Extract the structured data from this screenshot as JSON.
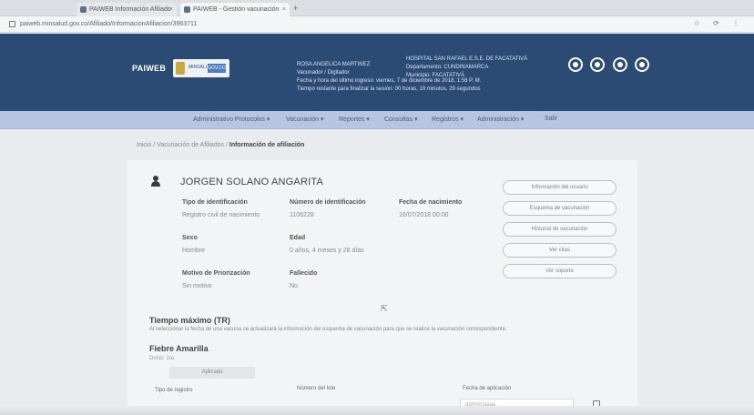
{
  "browser": {
    "tabs": [
      {
        "label": "PAIWEB Información Afiliado"
      },
      {
        "label": "PAIWEB - Gestión vacunación"
      }
    ],
    "new_tab_symbol": "+",
    "url": "paiweb.minsalud.gov.co/Afiliado/InformacionAfiliacion/3963711",
    "toolbar_icons": "☆ ⟳ ⋮"
  },
  "header": {
    "brand": "PAIWEB",
    "gov_label": "MINSALUD",
    "gov_badge": "GOV.CO",
    "user_name": "ROSA ANGELICA MARTINEZ",
    "user_role": "Vacunador / Digitador",
    "session_line_1": "Fecha y hora del último ingreso: viernes, 7 de diciembre de 2018, 1:56 P. M.",
    "session_line_2": "Tiempo restante para finalizar la sesión: 00 horas, 19 minutos, 29 segundos",
    "entity_name": "HOSPITAL SAN RAFAEL E.S.E. DE FACATATIVÁ",
    "entity_dept": "Departamento: CUNDINAMARCA",
    "entity_city": "Municipio: FACATATIVÁ"
  },
  "nav": {
    "items": [
      "Administrativo Protocolos ▾",
      "Vacunación ▾",
      "Reportes ▾",
      "Consultas ▾",
      "Registros ▾",
      "Administración ▾",
      "Salir"
    ]
  },
  "breadcrumb": {
    "home": "Inicio",
    "sep": "/",
    "middle": "Vacunación de Afiliados",
    "current": "Información de afiliación"
  },
  "person": {
    "name": "JORGEN SOLANO ANGARITA",
    "fields": [
      {
        "label": "Tipo de identificación",
        "value": "Registro civil de nacimiento"
      },
      {
        "label": "Número de identificación",
        "value": "1106228"
      },
      {
        "label": "Fecha de nacimiento",
        "value": "16/07/2018 00:00"
      },
      {
        "label": "Sexo",
        "value": "Hombre"
      },
      {
        "label": "Edad",
        "value": "0 años, 4 meses y 28 días"
      },
      {
        "label": "Motivo de Priorización",
        "value": "Sin motivo"
      },
      {
        "label": "Fallecido",
        "value": "No"
      }
    ]
  },
  "actions": [
    "Información del usuario",
    "Esquema de vacunación",
    "Historial de vacunación",
    "Ver citas",
    "Ver soporte"
  ],
  "section": {
    "title": "Tiempo máximo (TR)",
    "description": "Al seleccionar la fecha de una vacuna se actualizará la información del esquema de vacunación para que se realice la vacunación correspondiente.",
    "sub_title": "Fiebre Amarilla",
    "sub_line": "Dosis: 1ra",
    "pill_label": "Aplicado"
  },
  "bottom": {
    "label_1": "Tipo de registro",
    "label_2": "Número del lote",
    "label_3": "Fecha de aplicación",
    "date_placeholder": "dd/mm/aaaa"
  },
  "icon_names": [
    "person-icon",
    "lock-icon",
    "calendar-icon",
    "user-circle-icon"
  ]
}
